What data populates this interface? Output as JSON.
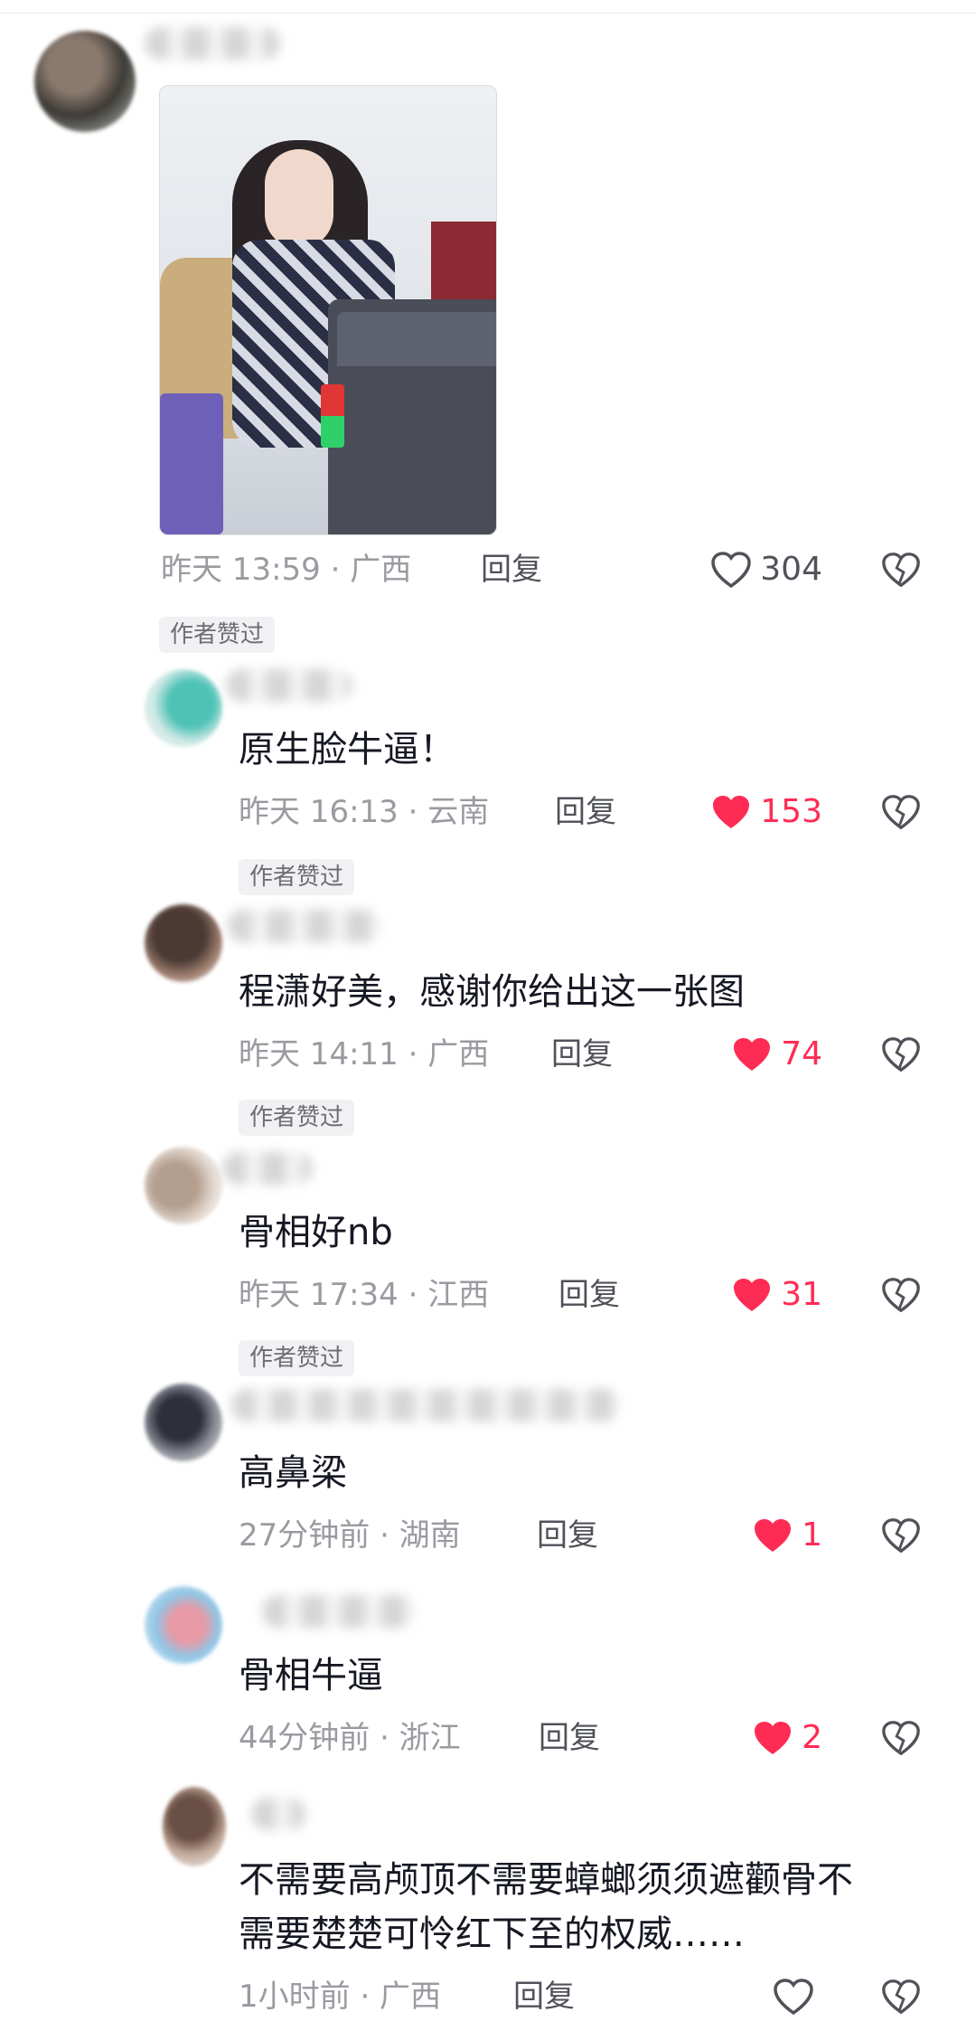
{
  "author_badge": "作者赞过",
  "comments": [
    {
      "meta": "昨天 13:59 · 广西",
      "reply": "回复",
      "likes": "304",
      "liked": false
    },
    {
      "text": "原生脸牛逼！",
      "meta": "昨天 16:13 · 云南",
      "reply": "回复",
      "likes": "153",
      "liked": true
    },
    {
      "text": "程潇好美，感谢你给出这一张图",
      "meta": "昨天 14:11 · 广西",
      "reply": "回复",
      "likes": "74",
      "liked": true
    },
    {
      "text": "骨相好nb",
      "meta": "昨天 17:34 · 江西",
      "reply": "回复",
      "likes": "31",
      "liked": true
    },
    {
      "text": "高鼻梁",
      "meta": "27分钟前 · 湖南",
      "reply": "回复",
      "likes": "1",
      "liked": true
    },
    {
      "text": "骨相牛逼",
      "meta": "44分钟前 · 浙江",
      "reply": "回复",
      "likes": "2",
      "liked": true
    },
    {
      "text_line1": "不需要高颅顶不需要蟑螂须须遮颧骨不",
      "text_line2": "需要楚楚可怜红下至的权威……",
      "meta": "1小时前 · 广西",
      "reply": "回复",
      "likes": "",
      "liked": false
    }
  ],
  "icons": {
    "like": "heart-icon",
    "dislike": "broken-heart-icon"
  },
  "colors": {
    "like_active": "#fe2c55",
    "meta": "#9a9ba1",
    "text": "#161823"
  }
}
